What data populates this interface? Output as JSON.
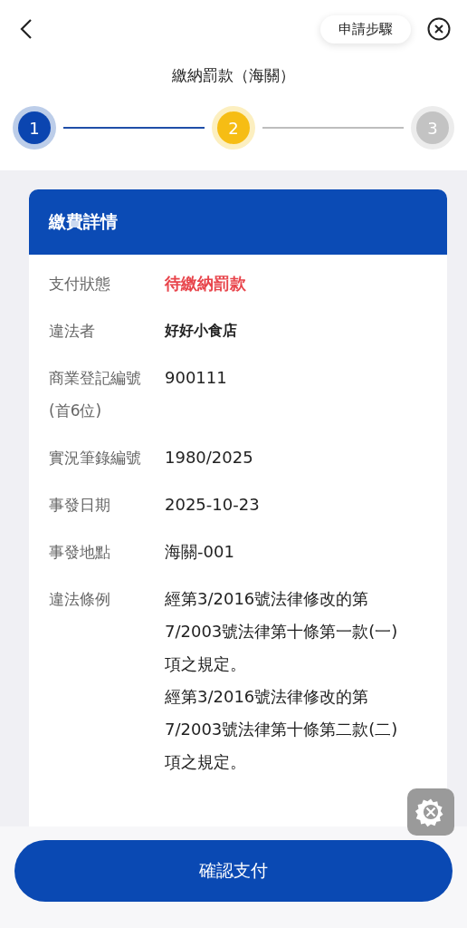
{
  "header": {
    "steps_button": "申請步驟",
    "title": "繳納罰款（海關）"
  },
  "steps": [
    {
      "label": "1",
      "kind": "done"
    },
    {
      "label": "2",
      "kind": "current"
    },
    {
      "label": "3",
      "kind": "pending"
    }
  ],
  "card": {
    "title": "繳費詳情",
    "rows": [
      {
        "label": "支付狀態",
        "kind": "status",
        "values": [
          "待繳納罰款"
        ]
      },
      {
        "label": "違法者",
        "kind": "bold",
        "values": [
          "好好小食店"
        ]
      },
      {
        "label": "商業登記編號(首6位)",
        "kind": "text",
        "values": [
          "900111"
        ]
      },
      {
        "label": "實況筆錄編號",
        "kind": "text",
        "values": [
          "1980/2025"
        ]
      },
      {
        "label": "事發日期",
        "kind": "text",
        "values": [
          "2025-10-23"
        ]
      },
      {
        "label": "事發地點",
        "kind": "text",
        "values": [
          "海關-001"
        ]
      },
      {
        "label": "違法條例",
        "kind": "text",
        "values": [
          "經第3/2016號法律修改的第7/2003號法律第十條第一款(一)項之規定。",
          "經第3/2016號法律修改的第7/2003號法律第十條第二款(二)項之規定。"
        ]
      }
    ]
  },
  "confirm_button": "確認支付"
}
